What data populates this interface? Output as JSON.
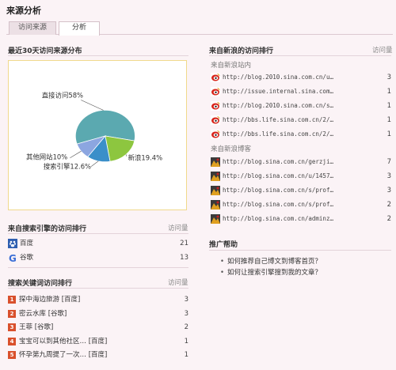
{
  "page": {
    "title": "来源分析"
  },
  "tabs": [
    {
      "label": "访问来源"
    },
    {
      "label": "分析"
    }
  ],
  "left": {
    "chart_title": "最近30天访问来源分布",
    "search_engine": {
      "title": "来自搜索引擎的访问排行",
      "col": "访问量",
      "rows": [
        {
          "name": "百度",
          "count": "21",
          "icon": "baidu-icon"
        },
        {
          "name": "谷歌",
          "count": "13",
          "icon": "google-icon"
        }
      ]
    },
    "keywords": {
      "title": "搜索关键词访问排行",
      "col": "访问量",
      "rows": [
        {
          "rank": "1",
          "text": "探中海边旅游 [百度]",
          "count": "3"
        },
        {
          "rank": "2",
          "text": "密云水库 [谷歌]",
          "count": "3"
        },
        {
          "rank": "3",
          "text": "王菲 [谷歌]",
          "count": "2"
        },
        {
          "rank": "4",
          "text": "宝宝可以到其他社区… [百度]",
          "count": "1"
        },
        {
          "rank": "5",
          "text": "怀孕第九周提了一次… [百度]",
          "count": "1"
        }
      ]
    }
  },
  "chart_data": {
    "type": "pie",
    "title": "最近30天访问来源分布",
    "slices": [
      {
        "label": "直接访问",
        "value": 58.0,
        "display": "直接访问58%",
        "color": "#5ba9b0"
      },
      {
        "label": "新浪",
        "value": 19.4,
        "display": "新浪19.4%",
        "color": "#8dc63f"
      },
      {
        "label": "搜索引擎",
        "value": 12.6,
        "display": "搜索引擎12.6%",
        "color": "#3b8fc9"
      },
      {
        "label": "其他网站",
        "value": 10.0,
        "display": "其他网站10%",
        "color": "#8ca6e0"
      }
    ]
  },
  "right": {
    "sina": {
      "title": "来自新浪的访问排行",
      "col": "访问量",
      "group1": "来自新浪站内",
      "group2": "来自新浪博客",
      "internal": [
        {
          "url": "http://blog.2010.sina.com.cn/u…",
          "count": "3"
        },
        {
          "url": "http://issue.internal.sina.com…",
          "count": "1"
        },
        {
          "url": "http://blog.2010.sina.com.cn/s…",
          "count": "1"
        },
        {
          "url": "http://bbs.life.sina.com.cn/2/…",
          "count": "1"
        },
        {
          "url": "http://bbs.life.sina.com.cn/2/…",
          "count": "1"
        }
      ],
      "blog": [
        {
          "url": "http://blog.sina.com.cn/gerzji…",
          "count": "7"
        },
        {
          "url": "http://blog.sina.com.cn/u/1457…",
          "count": "3"
        },
        {
          "url": "http://blog.sina.com.cn/s/prof…",
          "count": "3"
        },
        {
          "url": "http://blog.sina.com.cn/s/prof…",
          "count": "2"
        },
        {
          "url": "http://blog.sina.com.cn/adminz…",
          "count": "2"
        }
      ]
    },
    "help": {
      "title": "推广帮助",
      "items": [
        "如何推荐自己博文到博客首页？",
        "如何让搜索引擎搜到我的文章？"
      ]
    }
  }
}
